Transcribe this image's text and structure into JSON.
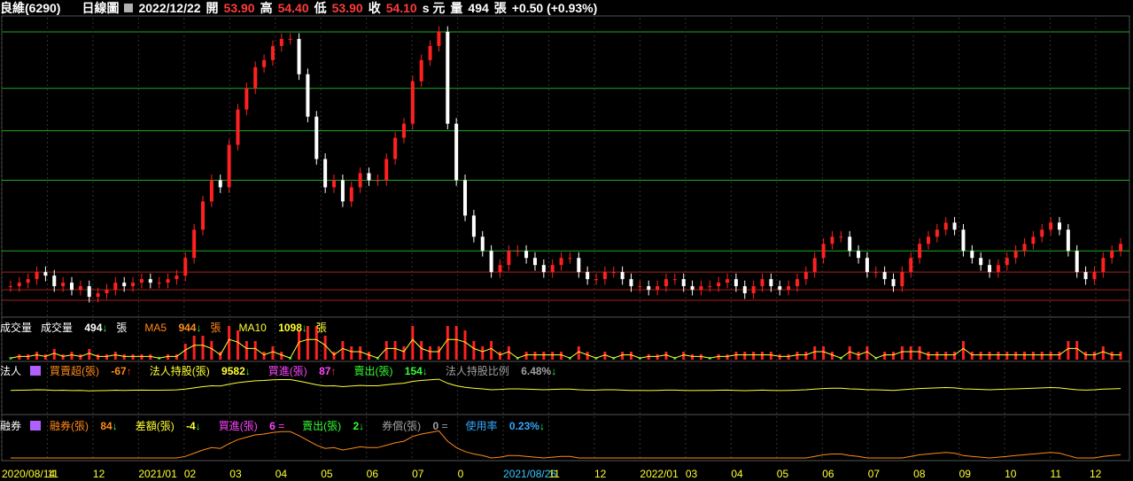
{
  "header": {
    "stock": "良維(6290)",
    "chart_kind": "日線圖",
    "date": "2022/12/22",
    "open_label": "開",
    "open": "53.90",
    "high_label": "高",
    "high": "54.40",
    "low_label": "低",
    "low": "53.90",
    "close_label": "收",
    "close": "54.10",
    "unit": "s 元",
    "vol_label": "量",
    "volume": "494",
    "vol_unit": "張",
    "change": "+0.50 (+0.93%)"
  },
  "volume_panel": {
    "title": "成交量",
    "vol_label": "成交量",
    "vol": "494",
    "vol_unit": "張",
    "ma5_label": "MA5",
    "ma5": "944",
    "ma5_unit": "張",
    "ma10_label": "MA10",
    "ma10": "1098",
    "ma10_unit": "張"
  },
  "inst_panel": {
    "title": "法人",
    "net_label": "買賣超(張)",
    "net": "-67",
    "hold_label": "法人持股(張)",
    "hold": "9582",
    "buy_label": "買進(張)",
    "buy": "87",
    "sell_label": "賣出(張)",
    "sell": "154",
    "ratio_label": "法人持股比例",
    "ratio": "6.48%"
  },
  "margin_panel": {
    "title": "融券",
    "short_label": "融券(張)",
    "short": "84",
    "diff_label": "差額(張)",
    "diff": "-4",
    "buy_label": "買進(張)",
    "buy": "6",
    "buy_sym": "=",
    "sell_label": "賣出(張)",
    "sell": "2",
    "repay_label": "券償(張)",
    "repay": "0",
    "repay_sym": "=",
    "usage_label": "使用率",
    "usage": "0.23%"
  },
  "colors": {
    "up": "#ff2020",
    "down": "#ffffff",
    "grid_green": "#22aa22",
    "grid_red": "#aa1f1f",
    "ma_yellow": "#ffff33"
  },
  "chart_data": {
    "type": "candlestick",
    "x_ticks": [
      "2020/08/14",
      "11",
      "12",
      "2021/01",
      "02",
      "03",
      "04",
      "05",
      "06",
      "07",
      "0",
      "2021/08/26",
      "11",
      "12",
      "2022/01",
      "03",
      "04",
      "05",
      "06",
      "07",
      "08",
      "09",
      "10",
      "11",
      "12"
    ],
    "close_series": [
      48,
      48.5,
      49,
      50,
      49.5,
      48,
      48.5,
      47.5,
      48,
      46.5,
      47,
      47.5,
      48.5,
      48,
      48.5,
      49,
      48.5,
      48.5,
      49,
      49.5,
      52,
      56,
      60,
      63,
      62,
      68,
      73,
      76,
      79,
      80,
      82,
      83,
      83,
      78,
      72,
      66,
      62,
      63,
      60,
      62,
      64,
      63,
      63,
      66,
      69,
      71,
      77,
      80,
      82,
      84,
      71,
      63,
      58,
      55,
      53,
      50,
      51,
      53,
      53,
      52,
      51,
      50,
      51,
      52,
      52,
      50,
      49,
      49,
      50,
      50,
      49,
      48,
      48,
      47.5,
      48,
      49,
      49,
      48,
      47.5,
      48,
      48,
      48.5,
      49,
      48,
      47,
      48,
      49,
      48,
      47.5,
      48,
      49,
      50,
      52,
      54,
      55,
      55,
      53,
      52,
      50,
      50,
      49,
      48,
      50,
      52,
      54,
      55,
      56,
      57,
      56,
      53,
      52,
      51,
      50,
      51,
      52,
      53,
      54,
      55,
      56,
      57,
      56,
      53,
      50,
      49,
      50,
      52,
      53,
      54
    ],
    "price_hint_levels": [
      84,
      76,
      70,
      63,
      53,
      50,
      47.5,
      46
    ],
    "volume_ma": "shown",
    "inst_hold_ratio_line": "shown",
    "margin_usage_line": "shown"
  }
}
